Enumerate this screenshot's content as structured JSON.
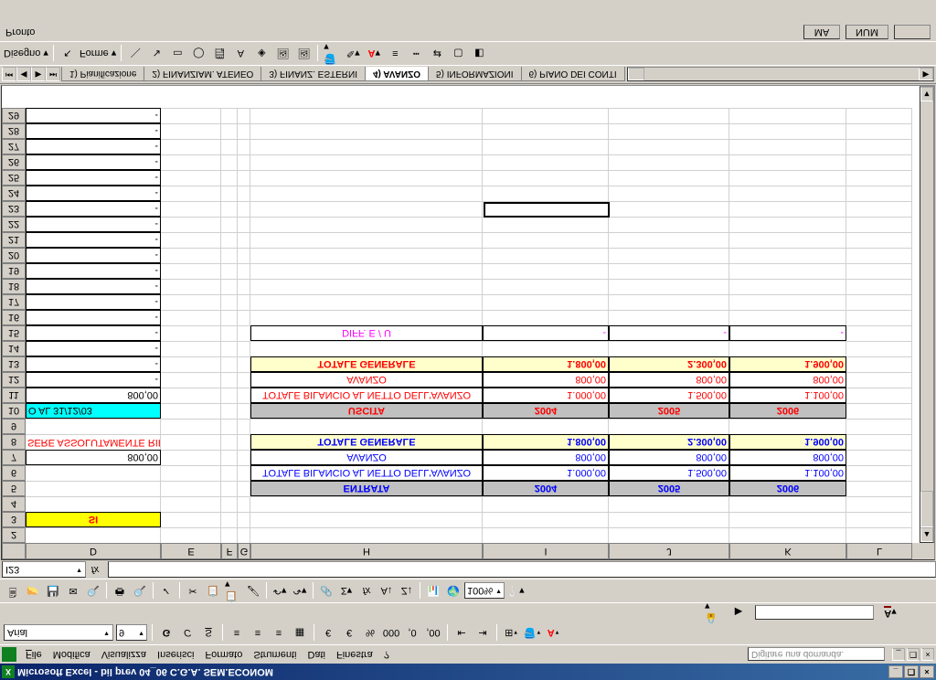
{
  "title": "Microsoft Excel - bil prev 04_06 C.G.A. SEM.ECONOM",
  "menu": {
    "file": "File",
    "modifica": "Modifica",
    "visualizza": "Visualizza",
    "inserisci": "Inserisci",
    "formato": "Formato",
    "strumenti": "Strumenti",
    "dati": "Dati",
    "finestra": "Finestra",
    "help": "?"
  },
  "askbox": "Digitare una domanda.",
  "font": {
    "name": "Arial",
    "size": "9"
  },
  "zoom": "100%",
  "namebox": "I23",
  "cols": [
    "D",
    "E",
    "F",
    "G",
    "H",
    "I",
    "J",
    "K",
    "L"
  ],
  "colW": {
    "D": "wD",
    "E": "wE",
    "F": "wF",
    "G": "wG",
    "H": "wH",
    "I": "wI",
    "J": "wJ",
    "K": "wK",
    "L": "wL"
  },
  "rows": [
    "2",
    "3",
    "4",
    "5",
    "6",
    "7",
    "8",
    "9",
    "10",
    "11",
    "12",
    "13",
    "14",
    "15",
    "16",
    "17",
    "18",
    "19",
    "20",
    "21",
    "22",
    "23",
    "24",
    "25",
    "26",
    "27",
    "28",
    "29"
  ],
  "d3": "SI",
  "d7": "800,00",
  "d8": "SERE ASSOLUTAMENTE RIPETUTI !",
  "d10": "O AL 31/12/03",
  "d11": "800,00",
  "dash": "-",
  "entrata": {
    "head": "ENTRATA",
    "y1": "2004",
    "y2": "2005",
    "y3": "2006",
    "r1l": "TOTALE BILANCIO AL NETTO DELL'AVANZO",
    "r1": [
      "1.000,00",
      "1.500,00",
      "1.100,00"
    ],
    "r2l": "AVANZO",
    "r2": [
      "800,00",
      "800,00",
      "800,00"
    ],
    "r3l": "TOTALE GENERALE",
    "r3": [
      "1.800,00",
      "2.300,00",
      "1.900,00"
    ]
  },
  "uscita": {
    "head": "USCITA",
    "y1": "2004",
    "y2": "2005",
    "y3": "2006",
    "r1l": "TOTALE BILANCIO AL NETTO DELL'AVANZO",
    "r1": [
      "1.000,00",
      "1.500,00",
      "1.100,00"
    ],
    "r2l": "AVANZO",
    "r2": [
      "800,00",
      "800,00",
      "800,00"
    ],
    "r3l": "TOTALE GENERALE",
    "r3": [
      "1.800,00",
      "2.300,00",
      "1.900,00"
    ]
  },
  "diff": {
    "label": "DIFF. E / U",
    "v": [
      "-",
      "-",
      "-"
    ]
  },
  "tabs": [
    "1) Pianificazione",
    "2) FINANZIAM. ATENEO",
    "3) FINANZ. ESTERNI",
    "4) AVANZO",
    "5) INFORMAZIONI",
    "6) PIANO DEI CONTI"
  ],
  "activeTab": 3,
  "draw": {
    "disegno": "Disegno",
    "forme": "Forme"
  },
  "status": {
    "ready": "Pronto",
    "maiusc": "MA",
    "num": "NUM"
  }
}
